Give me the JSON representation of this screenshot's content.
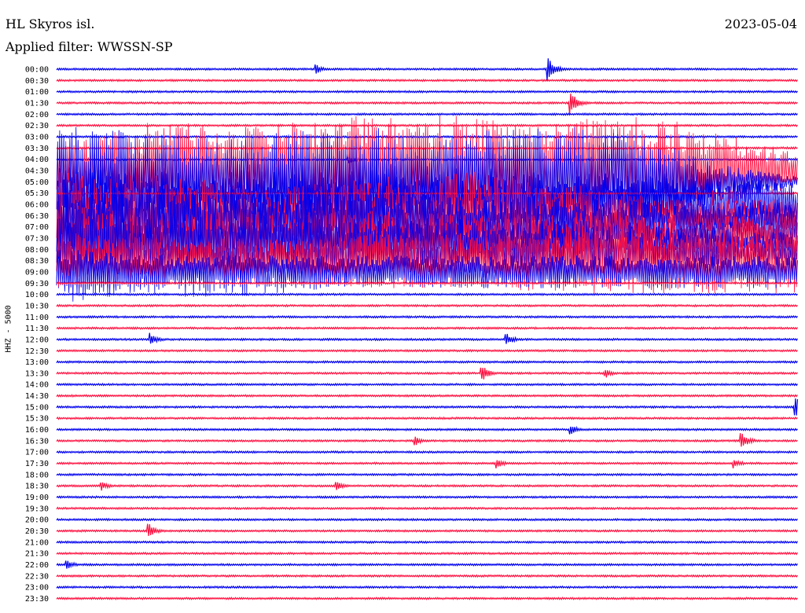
{
  "header": {
    "station": "HL Skyros isl.",
    "date": "2023-05-04",
    "filter": "Applied filter: WWSSN-SP"
  },
  "chart_data": {
    "type": "line",
    "kind": "helicorder",
    "channel_label": "HHZ - 5000",
    "colors": {
      "even": "#0000ee",
      "odd": "#ff1040"
    },
    "rows": [
      "00:00",
      "00:30",
      "01:00",
      "01:30",
      "02:00",
      "02:30",
      "03:00",
      "03:30",
      "04:00",
      "04:30",
      "05:00",
      "05:30",
      "06:00",
      "06:30",
      "07:00",
      "07:30",
      "08:00",
      "08:30",
      "09:00",
      "09:30",
      "10:00",
      "10:30",
      "11:00",
      "11:30",
      "12:00",
      "12:30",
      "13:00",
      "13:30",
      "14:00",
      "14:30",
      "15:00",
      "15:30",
      "16:00",
      "16:30",
      "17:00",
      "17:30",
      "18:00",
      "18:30",
      "19:00",
      "19:30",
      "20:00",
      "20:30",
      "21:00",
      "21:30",
      "22:00",
      "22:30",
      "23:00",
      "23:30"
    ],
    "row_duration_minutes": 30,
    "x_range_minutes": [
      0,
      30
    ],
    "active_rows": [
      {
        "row": "04:30",
        "envelope": [
          [
            1,
            0.6
          ],
          [
            4,
            0.9
          ],
          [
            8,
            0.8
          ],
          [
            12,
            1.0
          ],
          [
            16,
            1.0
          ],
          [
            19,
            0.9
          ],
          [
            24,
            1.0
          ],
          [
            27,
            0.7
          ],
          [
            30,
            0.3
          ]
        ]
      },
      {
        "row": "05:00",
        "envelope": [
          [
            1,
            1.0
          ],
          [
            2,
            0.9
          ],
          [
            3,
            1.0
          ],
          [
            6,
            0.8
          ],
          [
            9,
            0.9
          ],
          [
            13,
            1.0
          ],
          [
            15,
            0.7
          ],
          [
            18,
            1.0
          ],
          [
            21,
            1.0
          ],
          [
            24,
            0.8
          ],
          [
            27,
            0.3
          ],
          [
            30,
            0.1
          ]
        ]
      },
      {
        "row": "06:00",
        "envelope": [
          [
            1,
            0.9
          ],
          [
            4,
            0.7
          ],
          [
            7,
            0.6
          ],
          [
            10,
            0.8
          ],
          [
            14,
            0.8
          ],
          [
            18,
            0.7
          ],
          [
            22,
            0.6
          ],
          [
            26,
            0.6
          ],
          [
            30,
            0.4
          ]
        ]
      },
      {
        "row": "06:30",
        "envelope": [
          [
            1,
            0.8
          ],
          [
            5,
            0.7
          ],
          [
            9,
            0.5
          ],
          [
            13,
            0.7
          ],
          [
            17,
            0.8
          ],
          [
            21,
            0.6
          ],
          [
            25,
            0.3
          ],
          [
            30,
            0.3
          ]
        ]
      },
      {
        "row": "07:00",
        "envelope": [
          [
            1,
            0.9
          ],
          [
            4,
            0.8
          ],
          [
            8,
            0.7
          ],
          [
            12,
            0.8
          ],
          [
            16,
            0.6
          ],
          [
            20,
            0.6
          ],
          [
            24,
            0.5
          ],
          [
            30,
            0.5
          ]
        ]
      },
      {
        "row": "07:30",
        "envelope": [
          [
            1,
            0.6
          ],
          [
            5,
            0.5
          ],
          [
            9,
            0.5
          ],
          [
            13,
            0.5
          ],
          [
            18,
            0.4
          ],
          [
            22,
            0.5
          ],
          [
            26,
            0.4
          ],
          [
            30,
            0.4
          ]
        ]
      },
      {
        "row": "08:00",
        "envelope": [
          [
            1,
            1.0
          ],
          [
            3,
            0.8
          ],
          [
            6,
            0.9
          ],
          [
            10,
            0.8
          ],
          [
            14,
            0.6
          ],
          [
            18,
            0.6
          ],
          [
            23,
            0.5
          ],
          [
            30,
            0.3
          ]
        ]
      },
      {
        "row": "08:30",
        "envelope": [
          [
            1,
            0.5
          ],
          [
            5,
            0.4
          ],
          [
            9,
            0.4
          ],
          [
            13,
            0.5
          ],
          [
            17,
            0.5
          ],
          [
            21,
            0.6
          ],
          [
            25,
            0.6
          ],
          [
            30,
            0.6
          ]
        ]
      },
      {
        "row": "09:00",
        "envelope": [
          [
            1,
            0.4
          ],
          [
            5,
            0.3
          ],
          [
            9,
            0.3
          ],
          [
            13,
            0.3
          ],
          [
            17,
            0.3
          ],
          [
            21,
            0.3
          ],
          [
            25,
            0.3
          ],
          [
            30,
            0.3
          ]
        ]
      }
    ],
    "events": [
      {
        "row": "00:00",
        "minute": 10.5,
        "amplitude": 0.3
      },
      {
        "row": "00:00",
        "minute": 19.9,
        "amplitude": 0.7
      },
      {
        "row": "01:30",
        "minute": 20.8,
        "amplitude": 0.7
      },
      {
        "row": "04:00",
        "minute": 11.8,
        "amplitude": 0.3
      },
      {
        "row": "04:30",
        "minute": 3.2,
        "amplitude": 0.3
      },
      {
        "row": "12:00",
        "minute": 3.8,
        "amplitude": 0.4
      },
      {
        "row": "12:00",
        "minute": 18.2,
        "amplitude": 0.4
      },
      {
        "row": "13:30",
        "minute": 17.2,
        "amplitude": 0.5
      },
      {
        "row": "13:30",
        "minute": 22.2,
        "amplitude": 0.3
      },
      {
        "row": "15:00",
        "minute": 29.9,
        "amplitude": 0.9
      },
      {
        "row": "16:00",
        "minute": 20.8,
        "amplitude": 0.3
      },
      {
        "row": "16:30",
        "minute": 14.5,
        "amplitude": 0.3
      },
      {
        "row": "16:30",
        "minute": 27.7,
        "amplitude": 0.6
      },
      {
        "row": "17:30",
        "minute": 17.8,
        "amplitude": 0.3
      },
      {
        "row": "17:30",
        "minute": 27.4,
        "amplitude": 0.3
      },
      {
        "row": "18:30",
        "minute": 1.8,
        "amplitude": 0.3
      },
      {
        "row": "18:30",
        "minute": 11.3,
        "amplitude": 0.3
      },
      {
        "row": "20:30",
        "minute": 3.7,
        "amplitude": 0.5
      },
      {
        "row": "22:00",
        "minute": 0.4,
        "amplitude": 0.3
      }
    ],
    "grid": false,
    "legend": "none"
  }
}
